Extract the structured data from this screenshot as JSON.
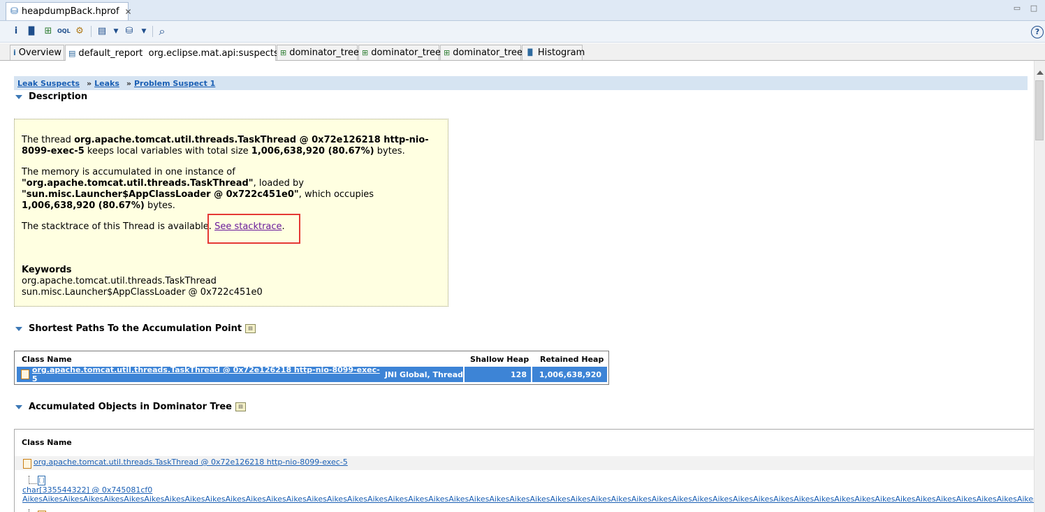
{
  "editor": {
    "tab_title": "heapdumpBack.hprof",
    "minimize": "▭",
    "maximize": "□"
  },
  "toolbar": {
    "info": "i",
    "histogram": "▐▌",
    "dominator": "⊞",
    "oql": "OQL",
    "gear": "⚙",
    "report": "▤",
    "query": "⛁",
    "search": "⌕",
    "help": "?"
  },
  "inner_tabs": [
    {
      "label": "Overview",
      "icon": "info-icon"
    },
    {
      "label": "default_report  org.eclipse.mat.api:suspects",
      "icon": "report-icon"
    },
    {
      "label": "dominator_tree",
      "icon": "tree-icon"
    },
    {
      "label": "dominator_tree",
      "icon": "tree-icon"
    },
    {
      "label": "dominator_tree",
      "icon": "tree-icon"
    },
    {
      "label": "Histogram",
      "icon": "histogram-icon"
    }
  ],
  "breadcrumb": {
    "items": [
      "Leak Suspects",
      "Leaks",
      "Problem Suspect 1"
    ],
    "separator": "»"
  },
  "description": {
    "heading": "Description",
    "p1_a": "The thread ",
    "p1_b": "org.apache.tomcat.util.threads.TaskThread @ 0x72e126218 http-nio-8099-exec-5",
    "p1_c": " keeps local variables with total size ",
    "p1_d": "1,006,638,920 (80.67%)",
    "p1_e": " bytes.",
    "p2_a": "The memory is accumulated in one instance of ",
    "p2_b": "\"org.apache.tomcat.util.threads.TaskThread\"",
    "p2_c": ", loaded by ",
    "p2_d": "\"sun.misc.Launcher$AppClassLoader @ 0x722c451e0\"",
    "p2_e": ", which occupies ",
    "p2_f": "1,006,638,920 (80.67%)",
    "p2_g": " bytes.",
    "p3_a": "The stacktrace of this Thread is available. ",
    "p3_link": "See stacktrace",
    "p3_end": ".",
    "keywords_heading": "Keywords",
    "keyword1": "org.apache.tomcat.util.threads.TaskThread",
    "keyword2": "sun.misc.Launcher$AppClassLoader @ 0x722c451e0"
  },
  "shortest_paths": {
    "heading": "Shortest Paths To the Accumulation Point",
    "columns": [
      "Class Name",
      "Shallow Heap",
      "Retained Heap"
    ],
    "row": {
      "class_link": "org.apache.tomcat.util.threads.TaskThread @ 0x72e126218 http-nio-8099-exec-5",
      "class_suffix": " JNI Global, Thread",
      "shallow": "128",
      "retained": "1,006,638,920"
    }
  },
  "accumulated": {
    "heading": "Accumulated Objects in Dominator Tree",
    "column": "Class Name",
    "row1": "org.apache.tomcat.util.threads.TaskThread @ 0x72e126218 http-nio-8099-exec-5",
    "row2_a": "char[335544322] @ 0x745081cf0",
    "row2_b": "AikesAikesAikesAikesAikesAikesAikesAikesAikesAikesAikesAikesAikesAikesAikesAikesAikesAikesAikesAikesAikesAikesAikesAikesAikesAikesAikesAikesAikesAikesAikesAikesAikesAikesAikesAikesAikesAikesAikesAikesAikesAikesAikesAikesAikesAikesAikesAikesAikesAikesAikesAikesAikesAikesAikes"
  },
  "colors": {
    "selection": "#3d84d6",
    "description_bg": "#ffffe1",
    "breadcrumb_bg": "#d6e4f2",
    "highlight": "#e53935"
  }
}
